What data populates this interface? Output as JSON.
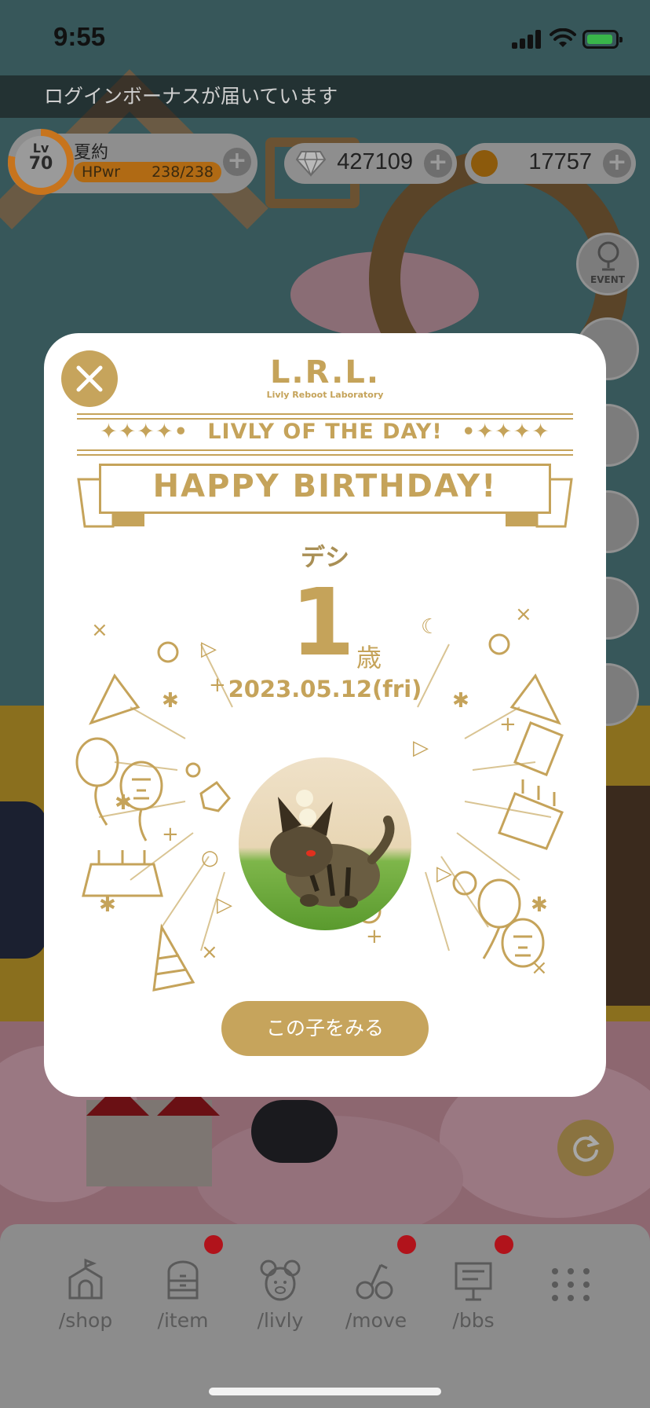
{
  "status_bar": {
    "time": "9:55"
  },
  "banner": {
    "text": "ログインボーナスが届いています"
  },
  "player": {
    "level_label": "Lv",
    "level": "70",
    "name": "夏約",
    "hp_label": "HPwr",
    "hp_value": "238/238"
  },
  "currency": {
    "gems": "427109",
    "coins": "17757"
  },
  "side_menu": {
    "event_label": "EVENT"
  },
  "modal": {
    "logo_main": "L.R.L.",
    "logo_sub": "Livly Reboot Laboratory",
    "lotd_title": "LIVLY OF THE DAY!",
    "lotd_left_deco": "✦✦✦✦•",
    "lotd_right_deco": "•✦✦✦✦",
    "ribbon_text": "HAPPY BIRTHDAY!",
    "pet_name": "デシ",
    "age": "1",
    "age_unit": "歳",
    "birthdate": "2023.05.12(fri)",
    "view_button": "この子をみる"
  },
  "nav": {
    "items": [
      {
        "label": "/shop",
        "badge": false
      },
      {
        "label": "/item",
        "badge": true
      },
      {
        "label": "/livly",
        "badge": false
      },
      {
        "label": "/move",
        "badge": true
      },
      {
        "label": "/bbs",
        "badge": true
      }
    ]
  },
  "colors": {
    "gold": "#c5a35a",
    "button_gold": "#c6a45c",
    "badge_red": "#b1131b",
    "modal_bg": "#ffffff"
  }
}
